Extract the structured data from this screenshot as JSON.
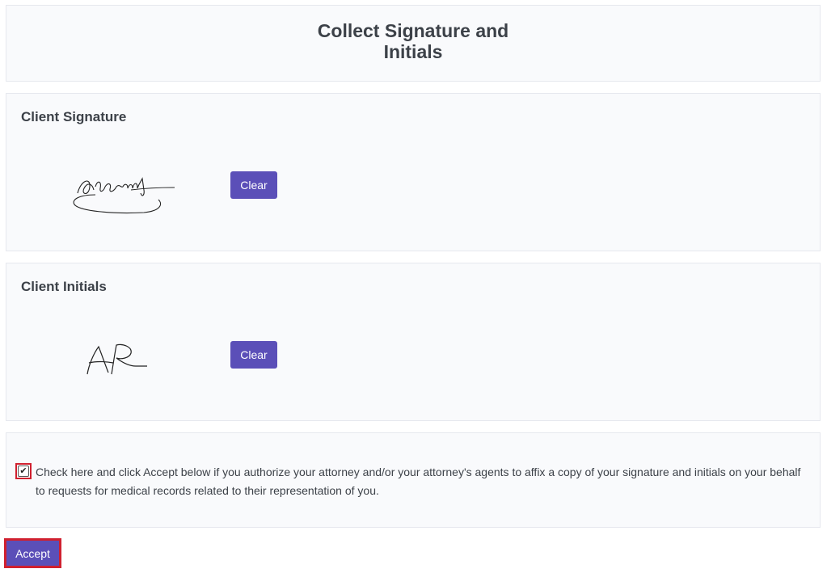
{
  "header": {
    "title": "Collect Signature and Initials"
  },
  "signature_section": {
    "heading": "Client Signature",
    "clear_label": "Clear"
  },
  "initials_section": {
    "heading": "Client Initials",
    "clear_label": "Clear"
  },
  "consent": {
    "checked": true,
    "text": "Check here and click Accept below if you authorize your attorney and/or your attorney's agents to affix a copy of your signature and initials on your behalf to requests for medical records related to their representation of you."
  },
  "footer": {
    "accept_label": "Accept"
  },
  "colors": {
    "primary_button": "#5b4fb8",
    "highlight_border": "#d0202f",
    "card_background": "#f9fafc",
    "text": "#3c4148"
  },
  "icons": {
    "checkbox_mark": "checkmark-icon"
  }
}
